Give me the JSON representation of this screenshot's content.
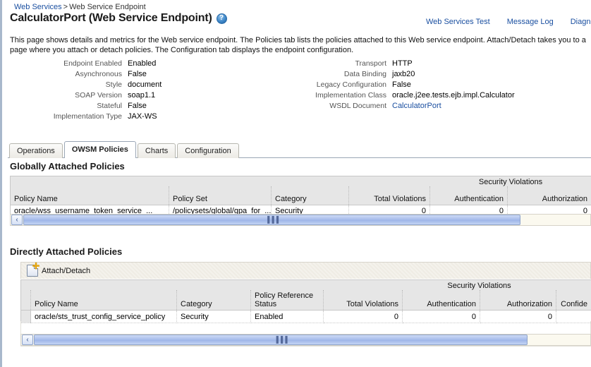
{
  "breadcrumb": {
    "root": "Web Services",
    "separator": ">",
    "current": "Web Service Endpoint"
  },
  "header": {
    "title": "CalculatorPort (Web Service Endpoint)",
    "help_icon": "help-circle-icon",
    "links": [
      {
        "label": "Web Services Test"
      },
      {
        "label": "Message Log"
      },
      {
        "label": "Diagnostic L"
      }
    ]
  },
  "description": "This page shows details and metrics for the Web service endpoint. The Policies tab lists the policies attached to this Web service endpoint. Attach/Detach takes you to a page where you attach or detach policies. The Configuration tab displays the endpoint configuration.",
  "properties_left": [
    {
      "label": "Endpoint Enabled",
      "value": "Enabled"
    },
    {
      "label": "Asynchronous",
      "value": "False"
    },
    {
      "label": "Style",
      "value": "document"
    },
    {
      "label": "SOAP Version",
      "value": "soap1.1"
    },
    {
      "label": "Stateful",
      "value": "False"
    },
    {
      "label": "Implementation Type",
      "value": "JAX-WS"
    }
  ],
  "properties_right": [
    {
      "label": "Transport",
      "value": "HTTP",
      "link": false
    },
    {
      "label": "Data Binding",
      "value": "jaxb20",
      "link": false
    },
    {
      "label": "Legacy Configuration",
      "value": "False",
      "link": false
    },
    {
      "label": "Implementation Class",
      "value": "oracle.j2ee.tests.ejb.impl.Calculator",
      "link": false
    },
    {
      "label": "WSDL Document",
      "value": "CalculatorPort",
      "link": true
    }
  ],
  "tabs": [
    {
      "label": "Operations",
      "active": false
    },
    {
      "label": "OWSM Policies",
      "active": true
    },
    {
      "label": "Charts",
      "active": false
    },
    {
      "label": "Configuration",
      "active": false
    }
  ],
  "global_section": {
    "title": "Globally Attached Policies",
    "group_header": "Security Violations",
    "columns": [
      "Policy Name",
      "Policy Set",
      "Category",
      "Total Violations",
      "Authentication",
      "Authorization"
    ],
    "rows": [
      {
        "policy_name": "oracle/wss_username_token_service_...",
        "policy_set": "/policysets/global/gpa_for_...",
        "category": "Security",
        "total_violations": "0",
        "authentication": "0",
        "authorization": "0"
      }
    ]
  },
  "direct_section": {
    "title": "Directly Attached Policies",
    "toolbar": {
      "attach_detach_label": "Attach/Detach",
      "attach_detach_icon": "attach-document-icon"
    },
    "group_header": "Security Violations",
    "columns": [
      "Policy Name",
      "Category",
      "Policy Reference Status",
      "Total Violations",
      "Authentication",
      "Authorization",
      "Confide"
    ],
    "rows": [
      {
        "policy_name": "oracle/sts_trust_config_service_policy",
        "category": "Security",
        "status": "Enabled",
        "total_violations": "0",
        "authentication": "0",
        "authorization": "0",
        "confidentiality": ""
      }
    ]
  },
  "scrollbars": {
    "left_arrow_glyph": "‹",
    "grip_glyph": "▐▐▐"
  },
  "colors": {
    "link": "#1a4fa0",
    "header_bg": "#e6e6e6",
    "scroll_thumb": "#a9beec"
  }
}
